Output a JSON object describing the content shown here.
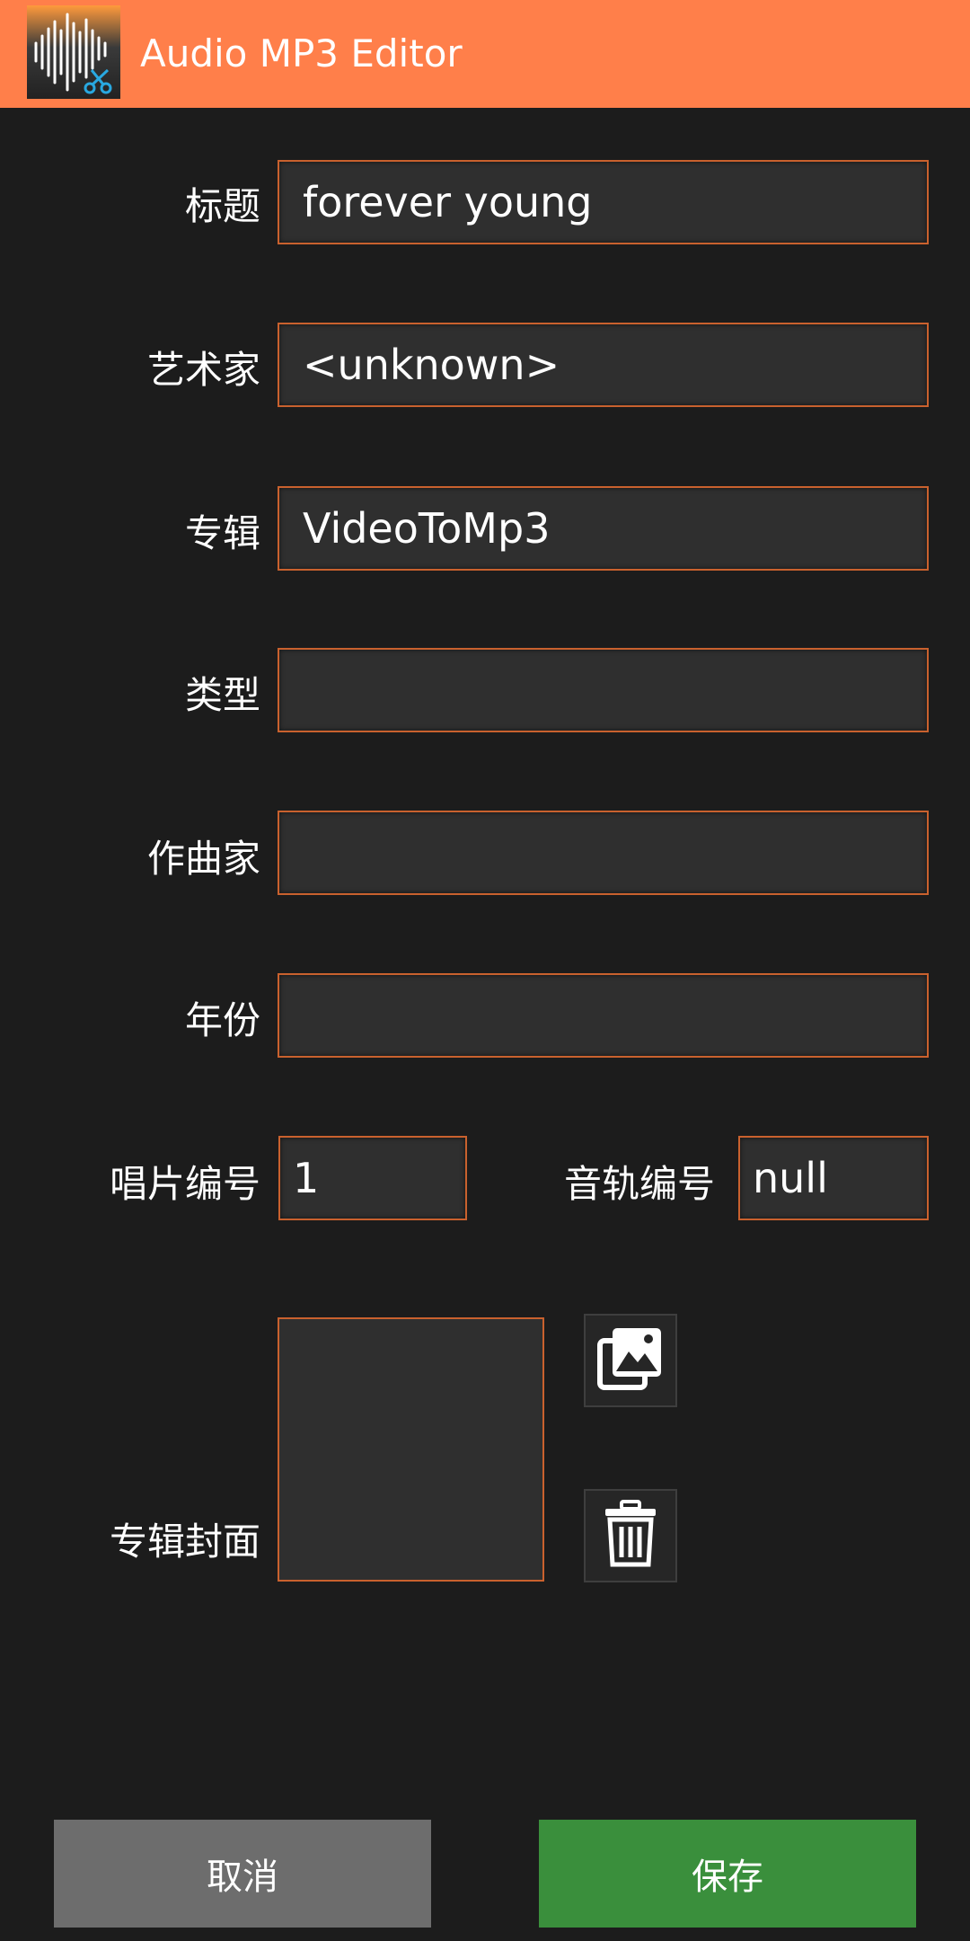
{
  "app": {
    "title": "Audio MP3 Editor",
    "icon": "waveform-scissors-icon"
  },
  "form": {
    "title_label": "标题",
    "title_value": "forever young",
    "artist_label": "艺术家",
    "artist_value": "<unknown>",
    "album_label": "专辑",
    "album_value": "VideoToMp3",
    "genre_label": "类型",
    "genre_value": "",
    "composer_label": "作曲家",
    "composer_value": "",
    "year_label": "年份",
    "year_value": "",
    "disc_label": "唱片编号",
    "disc_value": "1",
    "track_label": "音轨编号",
    "track_value": "null",
    "cover_label": "专辑封面"
  },
  "cover": {
    "pick_icon": "image-gallery-icon",
    "delete_icon": "trash-icon"
  },
  "buttons": {
    "cancel": "取消",
    "save": "保存"
  },
  "colors": {
    "appbar": "#ff7f4a",
    "background": "#1c1c1c",
    "field_border": "#c9612e",
    "cancel": "#6d6d6d",
    "save": "#3a8f3c"
  }
}
